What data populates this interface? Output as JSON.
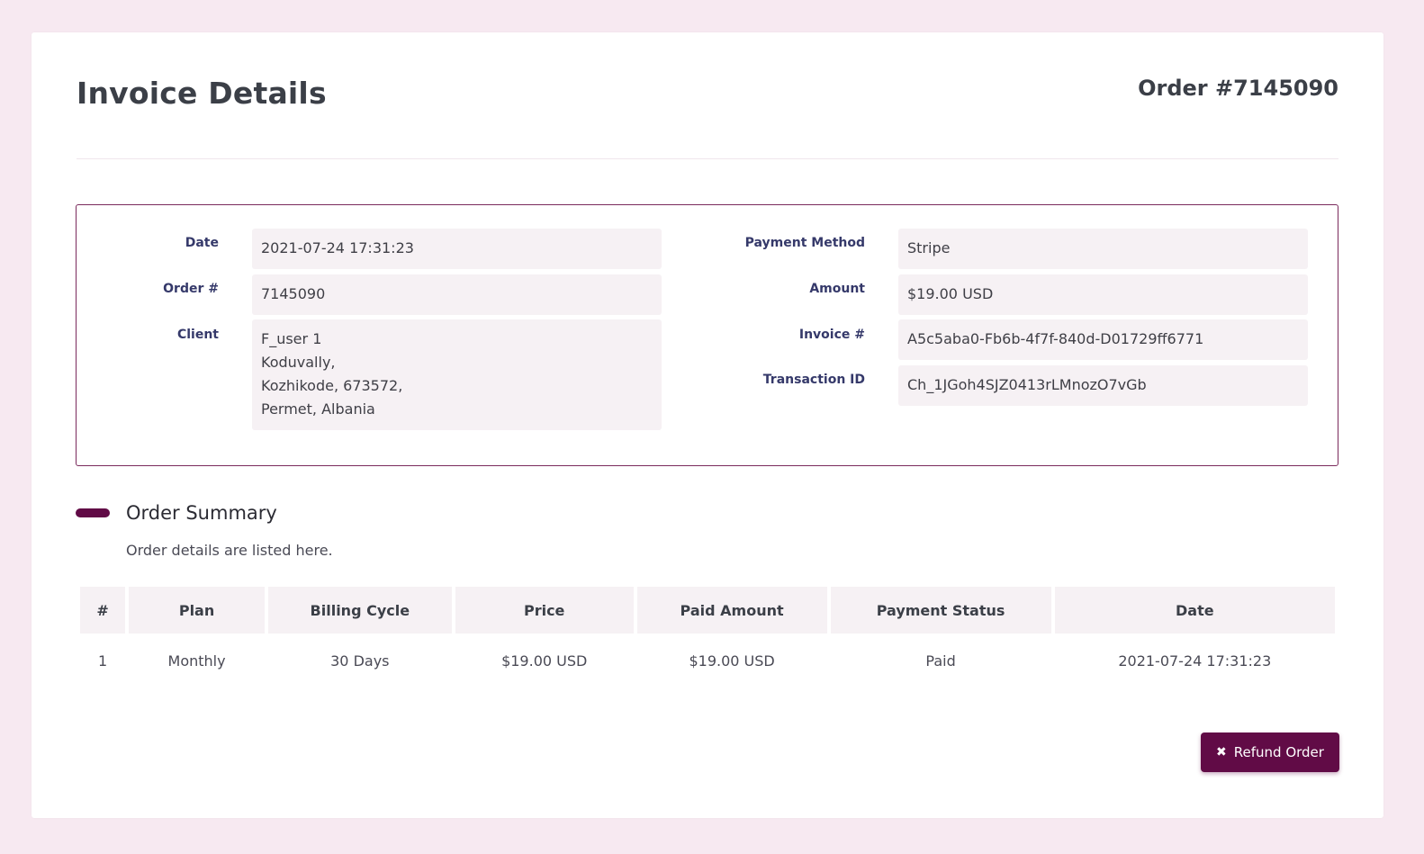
{
  "header": {
    "title": "Invoice Details",
    "order_number": "Order #7145090"
  },
  "details": {
    "date": {
      "label": "Date",
      "value": "2021-07-24 17:31:23"
    },
    "order": {
      "label": "Order #",
      "value": "7145090"
    },
    "client": {
      "label": "Client",
      "lines": [
        "F_user 1",
        "Koduvally,",
        "Kozhikode, 673572,",
        "Permet, Albania"
      ]
    },
    "payment_method": {
      "label": "Payment Method",
      "value": "Stripe"
    },
    "amount": {
      "label": "Amount",
      "value": "$19.00 USD"
    },
    "invoice": {
      "label": "Invoice #",
      "value": "A5c5aba0-Fb6b-4f7f-840d-D01729ff6771"
    },
    "transaction": {
      "label": "Transaction ID",
      "value": "Ch_1JGoh4SJZ0413rLMnozO7vGb"
    }
  },
  "summary": {
    "title": "Order Summary",
    "subtitle": "Order details are listed here.",
    "columns": [
      "#",
      "Plan",
      "Billing Cycle",
      "Price",
      "Paid Amount",
      "Payment Status",
      "Date"
    ],
    "rows": [
      [
        "1",
        "Monthly",
        "30 Days",
        "$19.00 USD",
        "$19.00 USD",
        "Paid",
        "2021-07-24 17:31:23"
      ]
    ]
  },
  "actions": {
    "refund_label": "Refund Order",
    "refund_icon": "close-icon"
  },
  "colors": {
    "accent": "#610b46",
    "background": "#f7e9f1",
    "field_background": "#f6f1f4"
  }
}
